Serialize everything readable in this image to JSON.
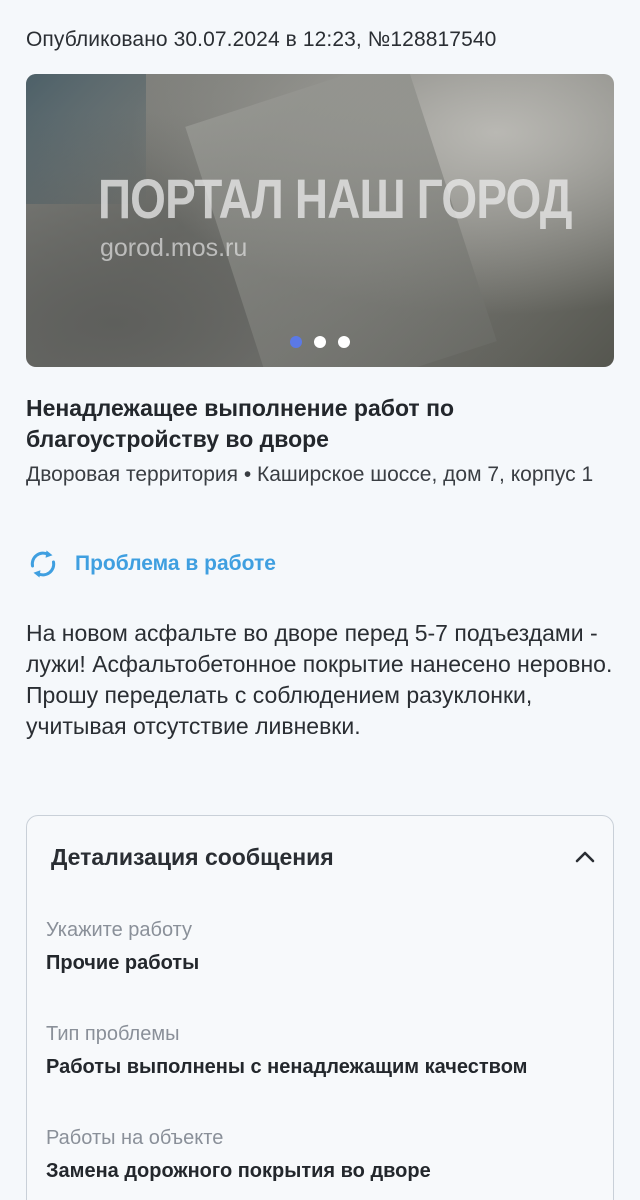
{
  "published": "Опубликовано 30.07.2024 в 12:23, №128817540",
  "gallery": {
    "watermark_title": "ПОРТАЛ НАШ ГОРОД",
    "watermark_url": "gorod.mos.ru",
    "slide_count": 3,
    "active_slide": 1
  },
  "problem": {
    "title": "Ненадлежащее выполнение работ по благоустройству во дворе",
    "location": "Дворовая территория • Каширское шоссе, дом 7, корпус 1"
  },
  "status": {
    "label": "Проблема в работе",
    "icon": "refresh-icon",
    "color": "#3f9fe0"
  },
  "description": "На новом асфальте во дворе перед 5-7 подъездами - лужи! Асфальтобетонное покрытие нанесено неровно. Прошу переделать с соблюдением разуклонки, учитывая отсутствие ливневки.",
  "details": {
    "title": "Детализация сообщения",
    "expanded": true,
    "fields": [
      {
        "label": "Укажите работу",
        "value": "Прочие работы"
      },
      {
        "label": "Тип проблемы",
        "value": "Работы выполнены с ненадлежащим качеством"
      },
      {
        "label": "Работы на объекте",
        "value": "Замена дорожного покрытия во дворе"
      }
    ]
  }
}
